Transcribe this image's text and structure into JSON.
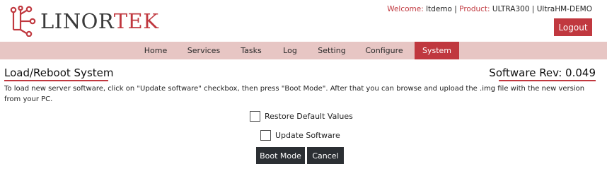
{
  "header": {
    "logo": {
      "text_dark": "LINOR",
      "text_red": "TEK"
    },
    "welcome_label": "Welcome:",
    "welcome_user": "ltdemo",
    "product_label": "Product:",
    "product_value": "ULTRA300 | UltraHM-DEMO",
    "separator": "|",
    "logout_label": "Logout"
  },
  "nav": {
    "items": [
      {
        "label": "Home"
      },
      {
        "label": "Services"
      },
      {
        "label": "Tasks"
      },
      {
        "label": "Log"
      },
      {
        "label": "Setting"
      },
      {
        "label": "Configure"
      },
      {
        "label": "System"
      }
    ],
    "active": "System"
  },
  "main": {
    "title": "Load/Reboot System",
    "software_rev": "Software Rev: 0.049",
    "description": "To load new server software, click on \"Update software\" checkbox, then press \"Boot Mode\". After that you can browse and upload the .img file with the new version from your PC.",
    "restore_defaults_label": "Restore Default Values",
    "restore_defaults_checked": false,
    "update_software_label": "Update Software",
    "update_software_checked": false,
    "boot_mode_label": "Boot Mode",
    "cancel_label": "Cancel"
  },
  "colors": {
    "accent": "#c0383f",
    "nav_background": "#e7c6c4",
    "button_dark": "#2b2f33"
  }
}
